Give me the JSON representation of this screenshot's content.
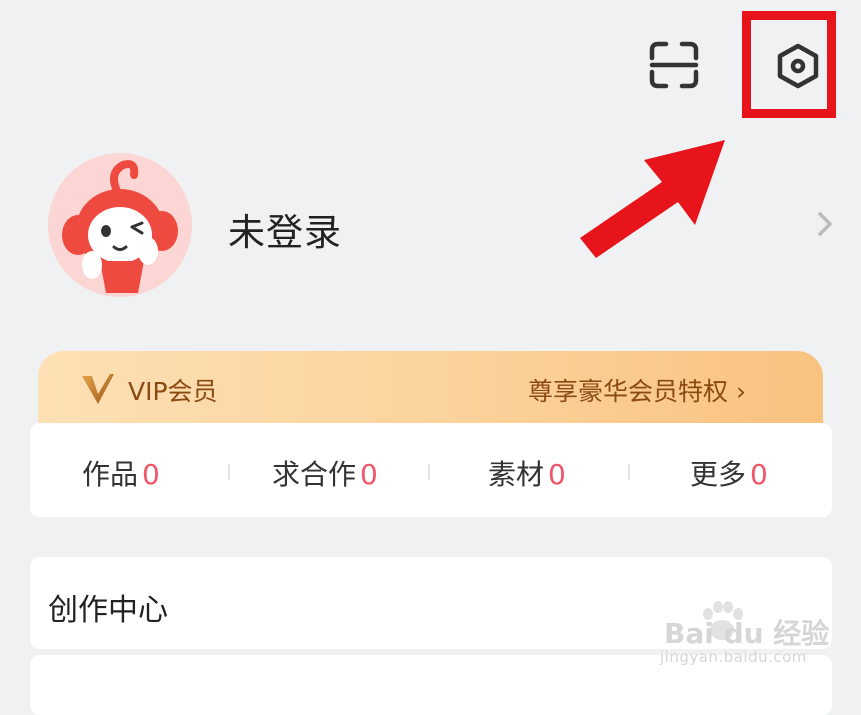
{
  "header": {
    "scan_icon": "scan-icon",
    "settings_icon": "settings-hexagon-icon"
  },
  "profile": {
    "avatar": "mascot-avatar",
    "username": "未登录",
    "chevron_icon": "chevron-right-icon"
  },
  "vip": {
    "title": "VIP会员",
    "link": "尊享豪华会员特权 ›",
    "colors": {
      "text": "#8a4a12",
      "start": "#fde0b5",
      "end": "#f9c27f"
    }
  },
  "stats": [
    {
      "label": "作品",
      "value": "0"
    },
    {
      "label": "求合作",
      "value": "0"
    },
    {
      "label": "素材",
      "value": "0"
    },
    {
      "label": "更多",
      "value": "0"
    }
  ],
  "menu": {
    "creation_center": "创作中心"
  },
  "watermark": {
    "text": "Bai du 经验",
    "url": "jingyan.baidu.com"
  },
  "annotation": {
    "highlight_color": "#e8141b"
  }
}
